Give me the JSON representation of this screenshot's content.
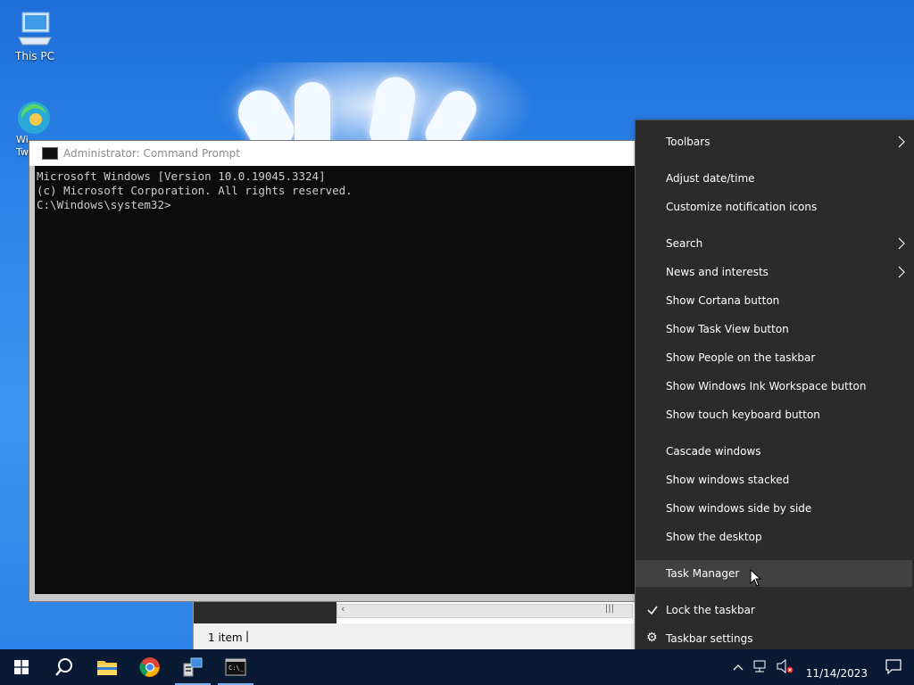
{
  "desktop": {
    "icons": [
      {
        "label": "This PC"
      },
      {
        "label": "Wi Tw"
      }
    ]
  },
  "cmd_window": {
    "title": "Administrator: Command Prompt",
    "lines": [
      "Microsoft Windows [Version 10.0.19045.3324]",
      "(c) Microsoft Corporation. All rights reserved.",
      "",
      "C:\\Windows\\system32>"
    ]
  },
  "explorer_window": {
    "status": "1 item"
  },
  "context_menu": {
    "items": [
      {
        "label": "Toolbars",
        "submenu": true
      },
      {
        "label": "Adjust date/time"
      },
      {
        "label": "Customize notification icons"
      },
      {
        "label": "Search",
        "submenu": true
      },
      {
        "label": "News and interests",
        "submenu": true
      },
      {
        "label": "Show Cortana button"
      },
      {
        "label": "Show Task View button"
      },
      {
        "label": "Show People on the taskbar"
      },
      {
        "label": "Show Windows Ink Workspace button"
      },
      {
        "label": "Show touch keyboard button"
      },
      {
        "label": "Cascade windows"
      },
      {
        "label": "Show windows stacked"
      },
      {
        "label": "Show windows side by side"
      },
      {
        "label": "Show the desktop"
      },
      {
        "label": "Task Manager",
        "highlighted": true
      },
      {
        "label": "Lock the taskbar",
        "checked": true
      },
      {
        "label": "Taskbar settings",
        "icon": "gear-icon"
      }
    ]
  },
  "taskbar": {
    "buttons": [
      "start-button",
      "search-button",
      "file-explorer",
      "chrome",
      "server-manager",
      "command-prompt"
    ],
    "clock": {
      "time": "",
      "date": "11/14/2023"
    }
  },
  "colors": {
    "menu_bg": "#2b2b2b",
    "menu_highlight": "#414141",
    "taskbar_bg": "#0a1a35",
    "console_bg": "#0c0c0c"
  }
}
